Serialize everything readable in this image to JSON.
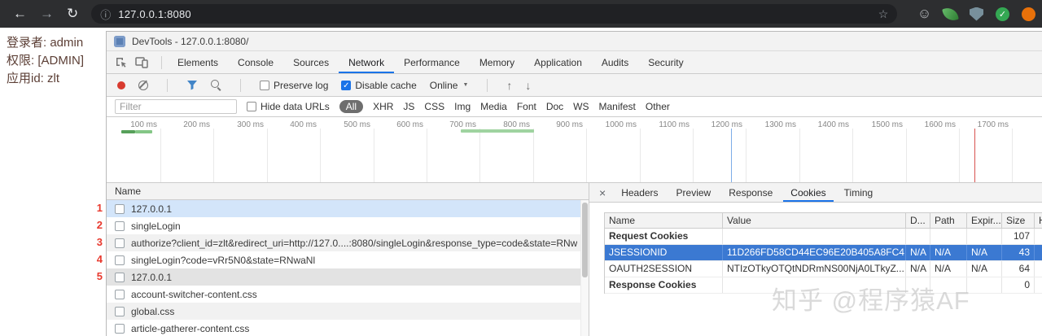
{
  "icons": {
    "back": "←",
    "forward": "→",
    "reload": "↻",
    "info": "ⓘ",
    "star": "☆",
    "smiley": "☺",
    "check": "✓",
    "caret": "▼",
    "upload": "↑",
    "download": "↓",
    "close": "×"
  },
  "browser": {
    "url": "127.0.0.1:8080"
  },
  "page": {
    "login_line": "登录者: admin",
    "perm_line": "权限: [ADMIN]",
    "app_line": "应用id: zlt",
    "annotations": [
      "1",
      "2",
      "3",
      "4",
      "5"
    ]
  },
  "devtools": {
    "window_title": "DevTools - 127.0.0.1:8080/",
    "main_tabs": [
      "Elements",
      "Console",
      "Sources",
      "Network",
      "Performance",
      "Memory",
      "Application",
      "Audits",
      "Security"
    ],
    "active_main_tab": "Network",
    "network_toolbar": {
      "preserve_log": "Preserve log",
      "disable_cache": "Disable cache",
      "throttling": "Online"
    },
    "filter_bar": {
      "placeholder": "Filter",
      "hide_data_urls": "Hide data URLs",
      "pills": [
        "All",
        "XHR",
        "JS",
        "CSS",
        "Img",
        "Media",
        "Font",
        "Doc",
        "WS",
        "Manifest",
        "Other"
      ],
      "active_pill": "All"
    },
    "timeline_labels": [
      "100 ms",
      "200 ms",
      "300 ms",
      "400 ms",
      "500 ms",
      "600 ms",
      "700 ms",
      "800 ms",
      "900 ms",
      "1000 ms",
      "1100 ms",
      "1200 ms",
      "1300 ms",
      "1400 ms",
      "1500 ms",
      "1600 ms",
      "1700 ms"
    ],
    "requests": {
      "column": "Name",
      "rows": [
        "127.0.0.1",
        "singleLogin",
        "authorize?client_id=zlt&redirect_uri=http://127.0....:8080/singleLogin&response_type=code&state=RNwaNl",
        "singleLogin?code=vRr5N0&state=RNwaNl",
        "127.0.0.1",
        "account-switcher-content.css",
        "global.css",
        "article-gatherer-content.css"
      ],
      "selected_row": "127.0.0.1"
    },
    "details": {
      "tabs": [
        "Headers",
        "Preview",
        "Response",
        "Cookies",
        "Timing"
      ],
      "active_tab": "Cookies",
      "cookies": {
        "columns": [
          "Name",
          "Value",
          "D...",
          "Path",
          "Expir...",
          "Size",
          "H"
        ],
        "request_group": "Request Cookies",
        "request_size": "107",
        "rows": [
          {
            "name": "JSESSIONID",
            "value": "11D266FD58CD44EC96E20B405A8FC4...",
            "domain": "N/A",
            "path": "N/A",
            "expires": "N/A",
            "size": "43",
            "selected": true
          },
          {
            "name": "OAUTH2SESSION",
            "value": "NTIzOTkyOTQtNDRmNS00NjA0LTkyZ...",
            "domain": "N/A",
            "path": "N/A",
            "expires": "N/A",
            "size": "64",
            "selected": false
          }
        ],
        "response_group": "Response Cookies",
        "response_size": "0"
      }
    }
  },
  "watermark": "知乎 @程序猿AF",
  "colors": {
    "accent": "#1a73e8",
    "selected_row_blue": "#3b79d2",
    "record_red": "#d83b2f",
    "annotation_red": "#e8392e"
  }
}
